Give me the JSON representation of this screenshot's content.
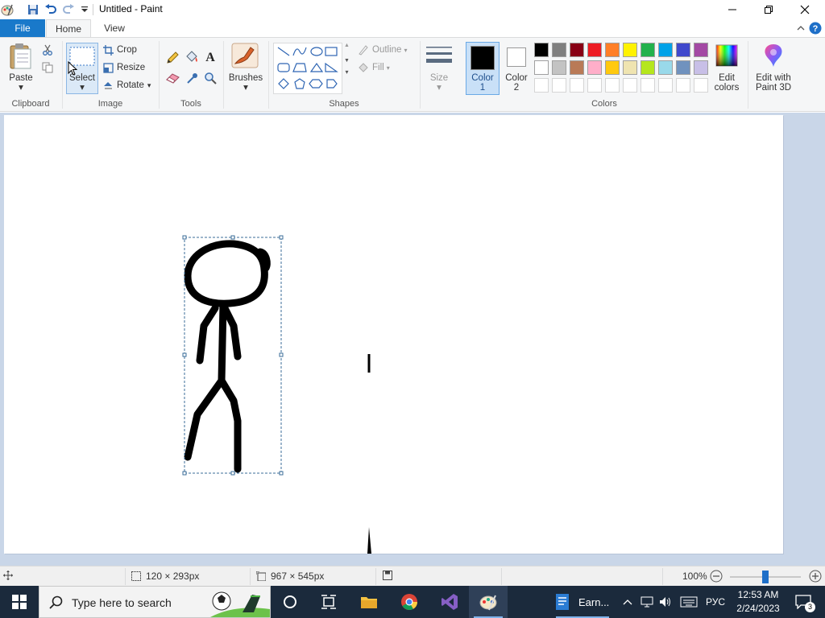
{
  "window": {
    "title": "Untitled - Paint"
  },
  "tabs": {
    "file": "File",
    "home": "Home",
    "view": "View"
  },
  "clipboard": {
    "paste": "Paste",
    "label": "Clipboard"
  },
  "image": {
    "select": "Select",
    "crop": "Crop",
    "resize": "Resize",
    "rotate": "Rotate",
    "label": "Image"
  },
  "tools": {
    "label": "Tools"
  },
  "brushes": {
    "label": "Brushes"
  },
  "shapes": {
    "outline": "Outline",
    "fill": "Fill",
    "label": "Shapes"
  },
  "size": {
    "label": "Size"
  },
  "colors": {
    "color1_line1": "Color",
    "color1_line2": "1",
    "color2_line1": "Color",
    "color2_line2": "2",
    "edit_line1": "Edit",
    "edit_line2": "colors",
    "paint3d_line1": "Edit with",
    "paint3d_line2": "Paint 3D",
    "label": "Colors",
    "color1_value": "#000000",
    "color2_value": "#ffffff",
    "palette_row1": [
      "#000000",
      "#7f7f7f",
      "#880015",
      "#ed1c24",
      "#ff7f27",
      "#fff200",
      "#22b14c",
      "#00a2e8",
      "#3f48cc",
      "#a349a4"
    ],
    "palette_row2": [
      "#ffffff",
      "#c3c3c3",
      "#b97a57",
      "#ffaec9",
      "#ffc90e",
      "#efe4b0",
      "#b5e61d",
      "#99d9ea",
      "#7092be",
      "#c8bfe7"
    ]
  },
  "status": {
    "selection_size": "120 × 293px",
    "canvas_size": "967 × 545px",
    "zoom": "100%",
    "zoom_level": 100
  },
  "taskbar": {
    "search_placeholder": "Type here to search",
    "app_label": "Earn...",
    "language": "РУС",
    "time": "12:53 AM",
    "date": "2/24/2023",
    "notifications": "3"
  }
}
